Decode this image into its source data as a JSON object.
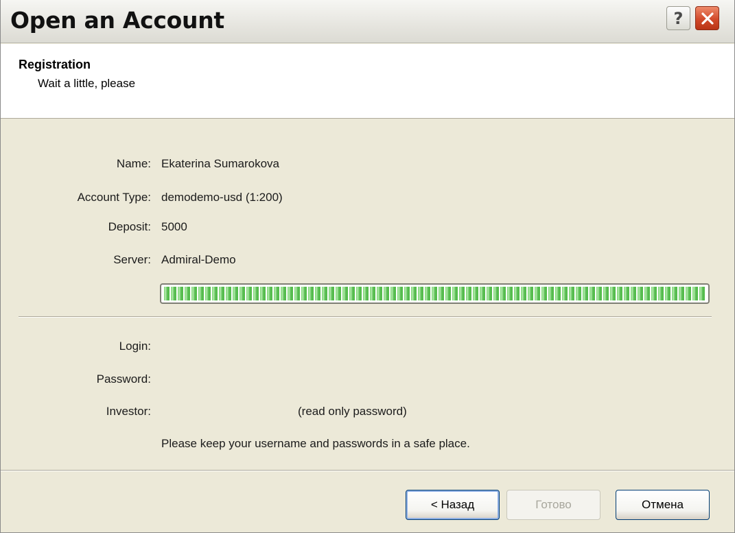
{
  "window": {
    "title": "Open an Account",
    "help_label": "?"
  },
  "header": {
    "title": "Registration",
    "subtitle": "Wait a little, please"
  },
  "details": {
    "name_label": "Name:",
    "name_value": "Ekaterina Sumarokova",
    "account_type_label": "Account Type:",
    "account_type_value": "demodemo-usd (1:200)",
    "deposit_label": "Deposit:",
    "deposit_value": "5000",
    "server_label": "Server:",
    "server_value": "Admiral-Demo"
  },
  "progress": {
    "fraction": 1.0
  },
  "credentials": {
    "login_label": "Login:",
    "password_label": "Password:",
    "investor_label": "Investor:",
    "investor_hint": "(read only password)",
    "notice": "Please keep your username and passwords in a safe place."
  },
  "buttons": {
    "back_label": "< Назад",
    "finish_label": "Готово",
    "cancel_label": "Отмена"
  },
  "icons": {
    "help": "help-icon",
    "close": "close-icon"
  }
}
